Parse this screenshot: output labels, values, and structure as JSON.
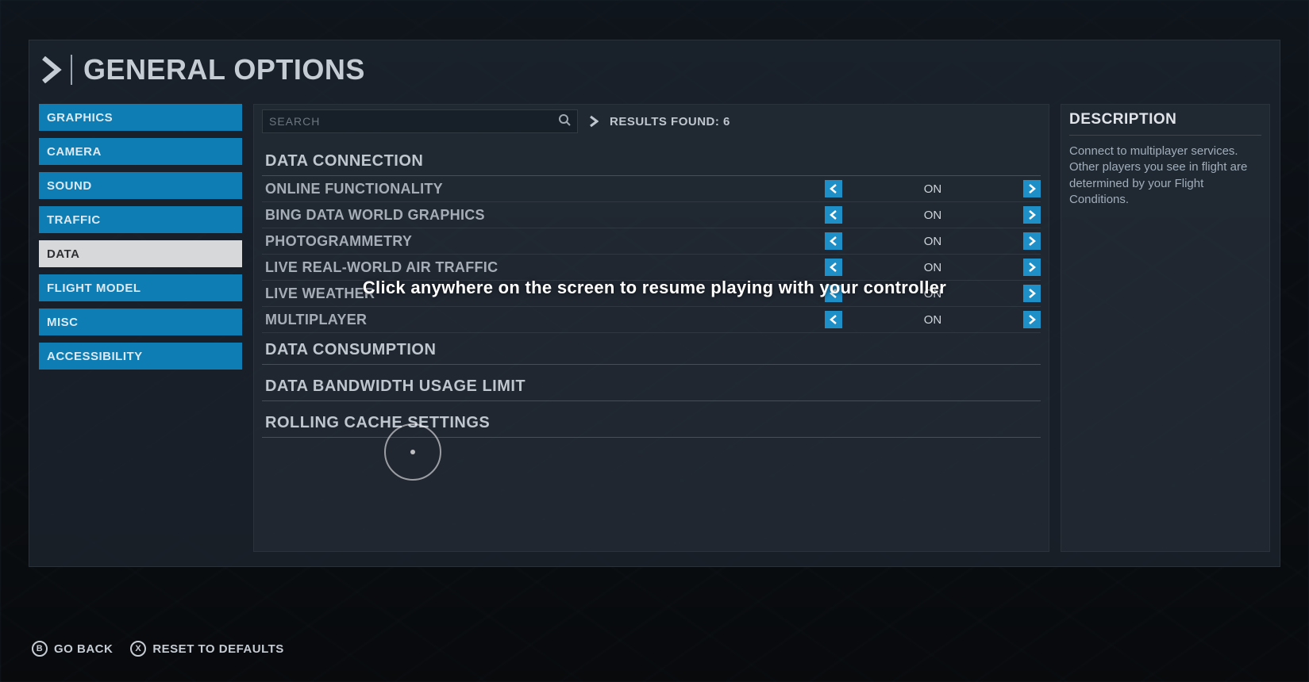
{
  "title": "GENERAL OPTIONS",
  "sidebar": {
    "items": [
      {
        "label": "GRAPHICS"
      },
      {
        "label": "CAMERA"
      },
      {
        "label": "SOUND"
      },
      {
        "label": "TRAFFIC"
      },
      {
        "label": "DATA"
      },
      {
        "label": "FLIGHT MODEL"
      },
      {
        "label": "MISC"
      },
      {
        "label": "ACCESSIBILITY"
      }
    ],
    "active_index": 4
  },
  "search": {
    "placeholder": "SEARCH",
    "results_label": "RESULTS FOUND: 6"
  },
  "sections": {
    "data_connection": {
      "header": "DATA CONNECTION",
      "rows": [
        {
          "label": "ONLINE FUNCTIONALITY",
          "value": "ON"
        },
        {
          "label": "BING DATA WORLD GRAPHICS",
          "value": "ON"
        },
        {
          "label": "PHOTOGRAMMETRY",
          "value": "ON"
        },
        {
          "label": "LIVE REAL-WORLD AIR TRAFFIC",
          "value": "ON"
        },
        {
          "label": "LIVE WEATHER",
          "value": "ON"
        },
        {
          "label": "MULTIPLAYER",
          "value": "ON"
        }
      ]
    },
    "data_consumption": {
      "header": "DATA CONSUMPTION"
    },
    "bandwidth": {
      "header": "DATA BANDWIDTH USAGE LIMIT"
    },
    "rolling_cache": {
      "header": "ROLLING CACHE SETTINGS"
    }
  },
  "description": {
    "title": "DESCRIPTION",
    "body": "Connect to multiplayer services. Other players you see in flight are determined by your Flight Conditions."
  },
  "footer": {
    "back_key": "B",
    "back_label": "GO BACK",
    "reset_key": "X",
    "reset_label": "RESET TO DEFAULTS"
  },
  "overlay": {
    "message": "Click anywhere on the screen to resume playing with your controller"
  }
}
